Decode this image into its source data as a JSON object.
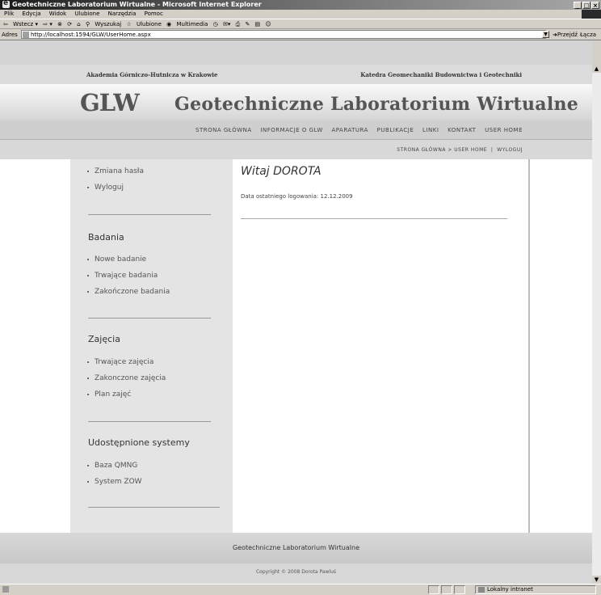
{
  "window": {
    "title": "Geotechniczne Laboratorium Wirtualne - Microsoft Internet Explorer"
  },
  "menu": [
    "Plik",
    "Edycja",
    "Widok",
    "Ulubione",
    "Narzędzia",
    "Pomoc"
  ],
  "toolbar": {
    "back": "Wstecz",
    "search": "Wyszukaj",
    "favorites": "Ulubione",
    "multimedia": "Multimedia"
  },
  "address": {
    "label": "Adres",
    "url": "http://localhost:1594/GLW/UserHome.aspx",
    "go": "Przejdź",
    "links": "Łącza"
  },
  "header": {
    "university": "Akademia Górniczo-Hutnicza w Krakowie",
    "department": "Katedra Geomechaniki Budownictwa i Geotechniki",
    "logo": "GLW",
    "site_title": "Geotechniczne Laboratorium Wirtualne"
  },
  "nav": [
    "STRONA GŁÓWNA",
    "INFORMACJE O GLW",
    "APARATURA",
    "PUBLIKACJE",
    "LINKI",
    "KONTAKT",
    "USER HOME"
  ],
  "breadcrumb": {
    "path": "STRONA GŁÓWNA > USER HOME",
    "sep": "|",
    "logout": "WYLOGUJ"
  },
  "sidebar": {
    "account": [
      "Zmiana hasła",
      "Wyloguj"
    ],
    "sections": [
      {
        "title": "Badania",
        "items": [
          "Nowe badanie",
          "Trwające badania",
          "Zakończone badania"
        ]
      },
      {
        "title": "Zajęcia",
        "items": [
          "Trwające zajęcia",
          "Zakonczone zajęcia",
          "Plan zajęć"
        ]
      },
      {
        "title": "Udostępnione systemy",
        "items": [
          "Baza QMNG",
          "System ZOW"
        ]
      }
    ]
  },
  "main": {
    "welcome": "Witaj DOROTA",
    "last_login": "Data ostatniego logowania: 12.12.2009"
  },
  "footer": {
    "title": "Geotechniczne Laboratorium Wirtualne",
    "copyright": "Copyright © 2008 Dorota Pawluś"
  },
  "status": {
    "zone": "Lokalny intranet"
  }
}
